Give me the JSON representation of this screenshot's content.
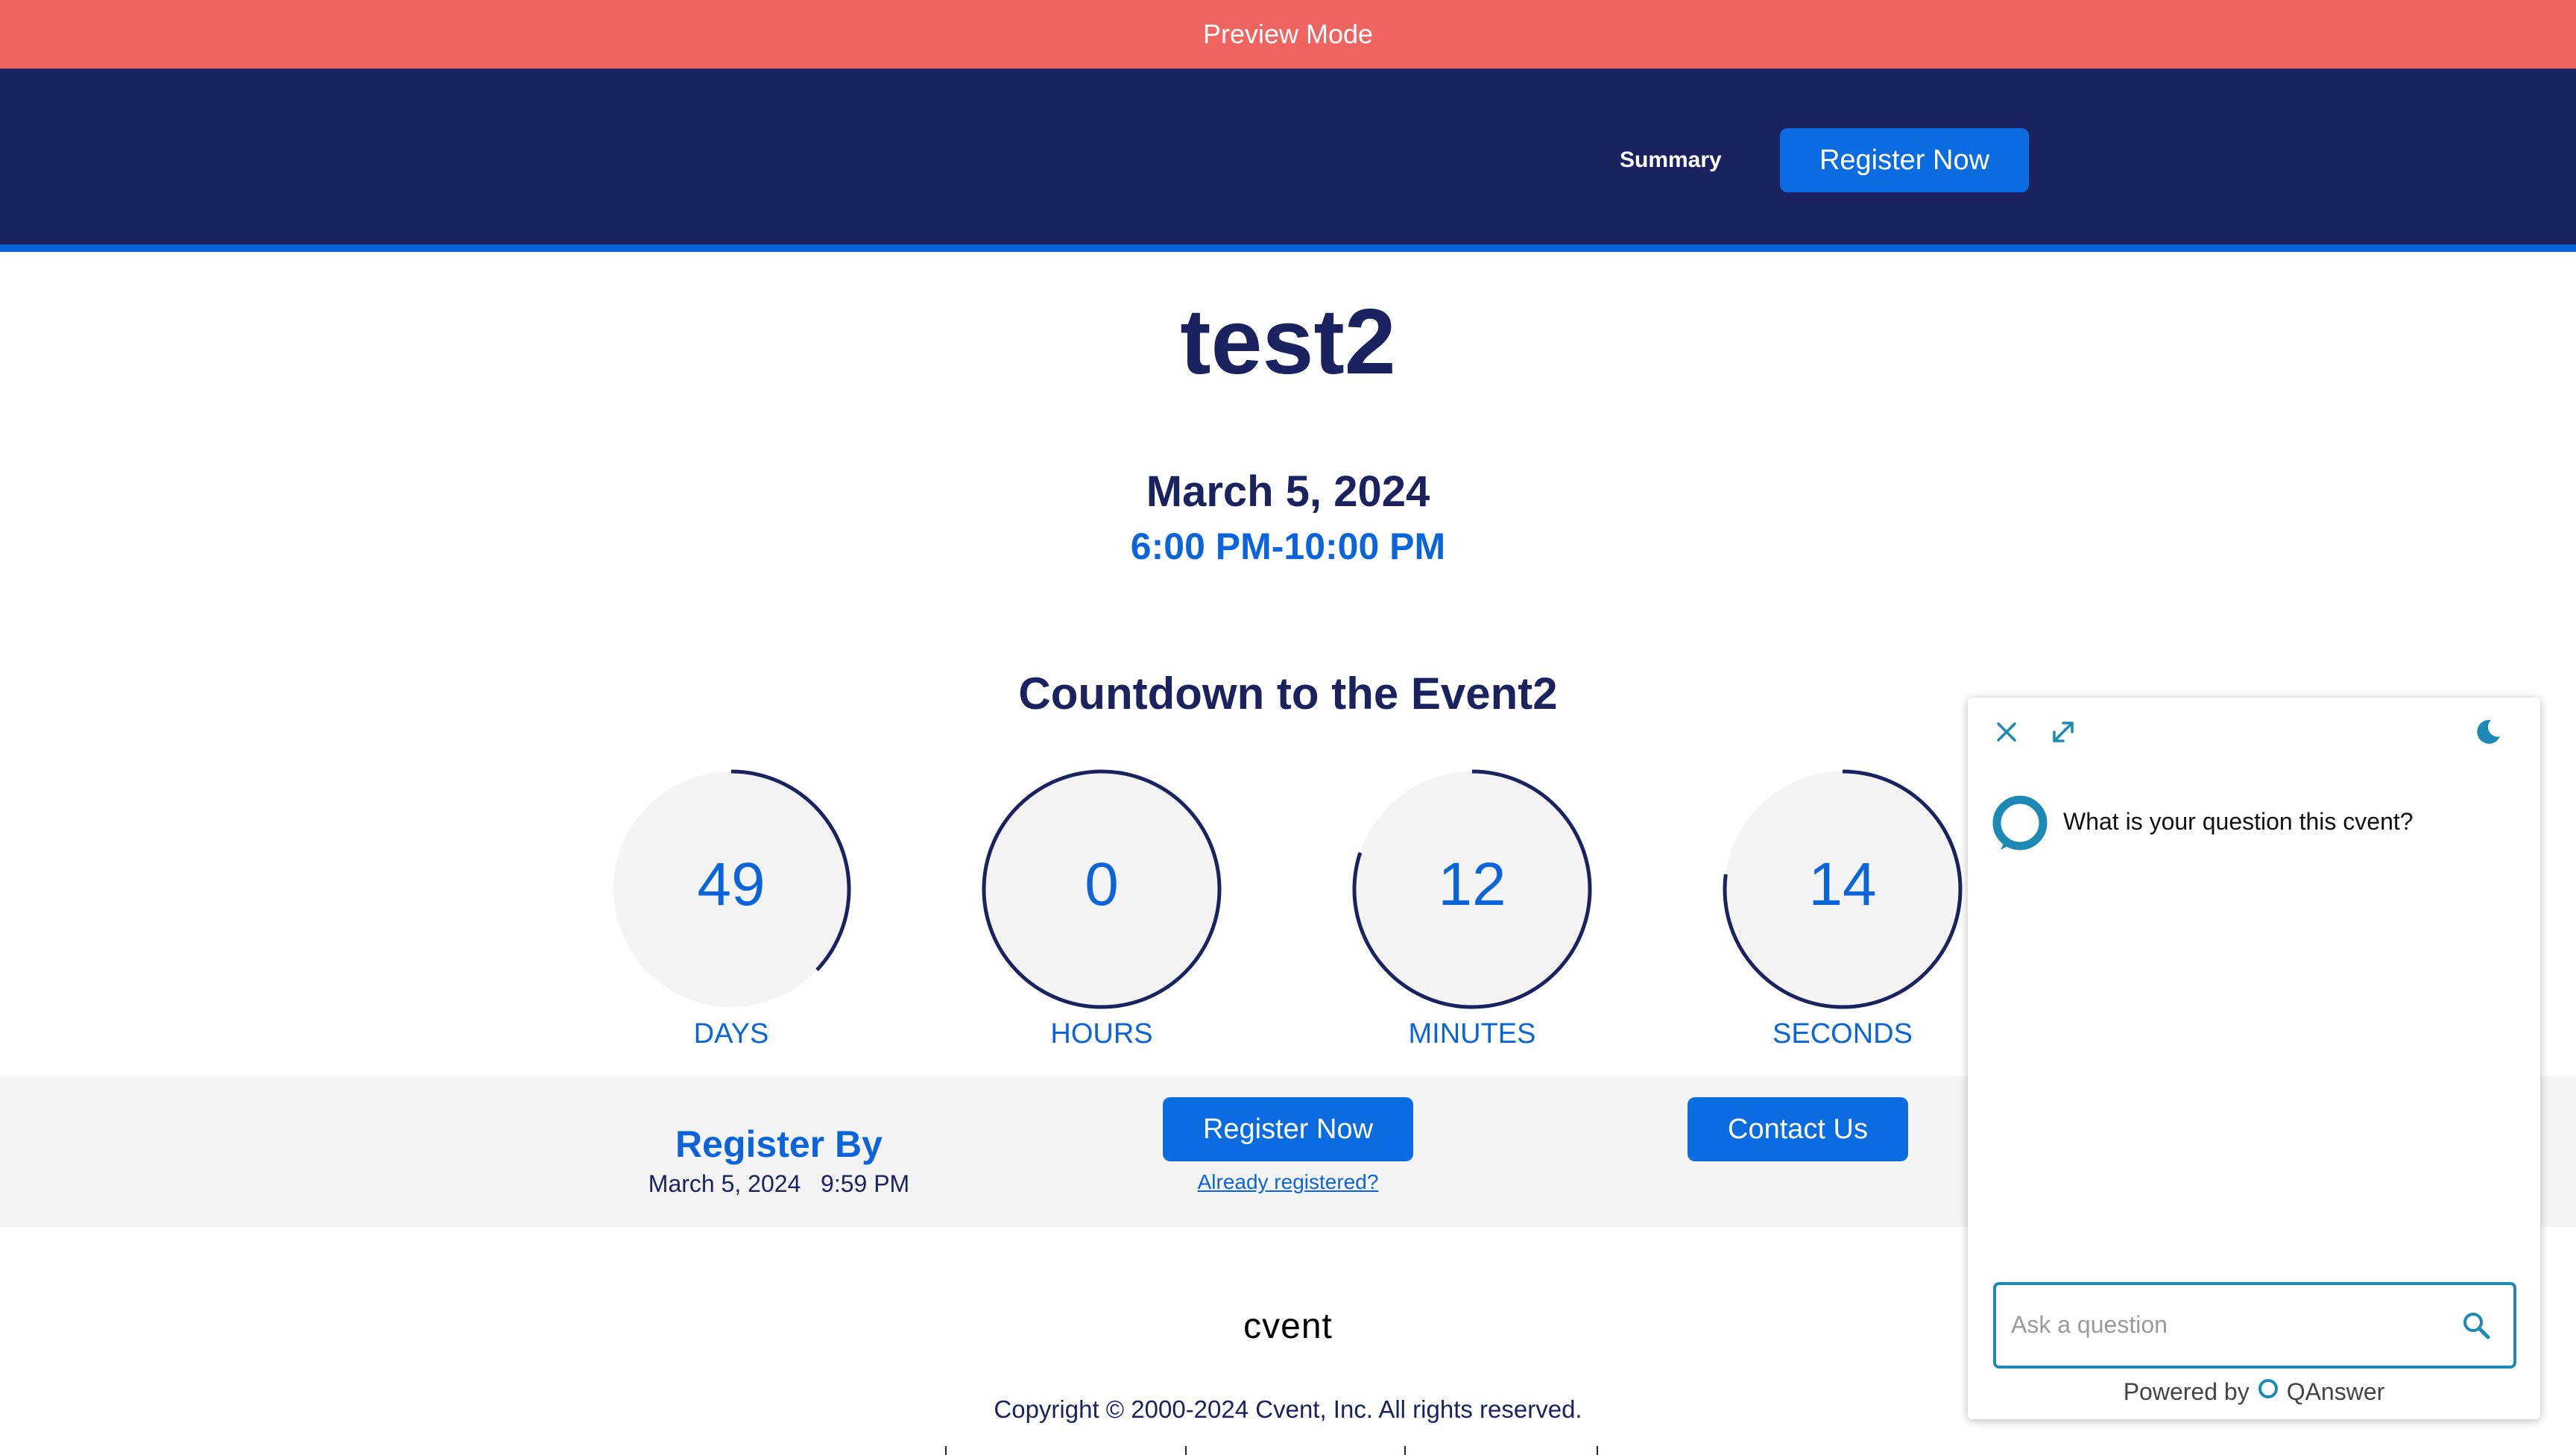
{
  "preview_bar": {
    "text": "Preview Mode"
  },
  "header": {
    "nav_summary": "Summary",
    "register_button": "Register Now"
  },
  "event": {
    "title": "test2",
    "date": "March 5, 2024",
    "time": "6:00 PM-10:00 PM"
  },
  "countdown": {
    "title": "Countdown to the Event2",
    "units": [
      {
        "value": "49",
        "label": "DAYS",
        "fraction": 0.37
      },
      {
        "value": "0",
        "label": "HOURS",
        "fraction": 1.0
      },
      {
        "value": "12",
        "label": "MINUTES",
        "fraction": 0.8
      },
      {
        "value": "14",
        "label": "SECONDS",
        "fraction": 0.77
      }
    ]
  },
  "registration": {
    "register_by_title": "Register By",
    "register_by_date": "March 5, 2024   9:59 PM",
    "register_button": "Register Now",
    "already_registered": "Already registered?",
    "contact_button": "Contact Us"
  },
  "footer": {
    "logo": "cvent",
    "copyright": "Copyright © 2000-2024 Cvent, Inc. All rights reserved."
  },
  "chat": {
    "bot_message": "What is your question this cvent?",
    "input_placeholder": "Ask a question",
    "powered_prefix": "Powered by",
    "powered_brand": "QAnswer"
  },
  "colors": {
    "navy": "#1a2360",
    "blue": "#0b64d9",
    "preview": "#ef6361",
    "chat_accent": "#1d8ab5"
  }
}
